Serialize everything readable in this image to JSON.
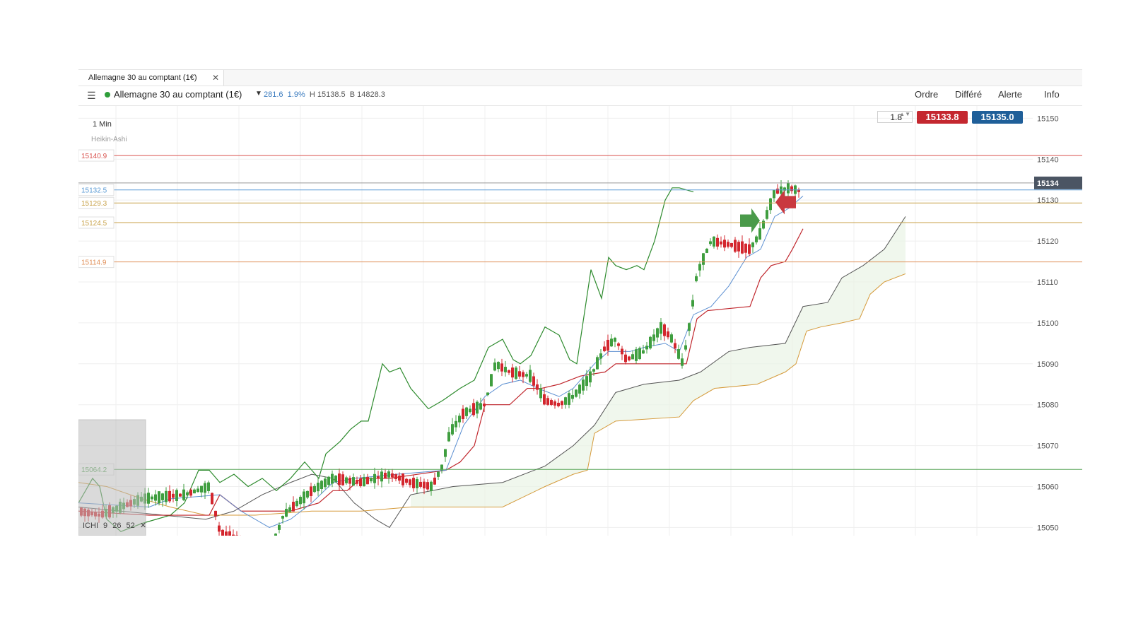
{
  "tab": {
    "label": "Allemagne 30 au comptant (1€)",
    "close": "✕"
  },
  "header": {
    "menu_icon": "☰",
    "instrument": "Allemagne 30 au comptant (1€)",
    "caret": "▼",
    "change": "281.6",
    "change_pct": "1.9%",
    "high": "H 15138.5",
    "low": "B 14828.3",
    "nav": [
      "Ordre",
      "Différé",
      "Alerte",
      "Info"
    ]
  },
  "toolbar": {
    "timeframe": "1 Min",
    "chart_type": "Heikin-Ashi",
    "quantity": "1.8",
    "qty_arrows": "▲▼",
    "sell_price": "15133.8",
    "buy_price": "15135.0"
  },
  "indicator": {
    "label": "ICHI 9 26 52",
    "close": "✕"
  },
  "colors": {
    "up": "#3f9e3f",
    "down": "#d3262e",
    "kijun": "#c0272d",
    "tenkan": "#5b8fd1",
    "chikou": "#2e8b2e",
    "cloud": "#e9f3e6",
    "span_a": "#555555",
    "span_b": "#d59a3a"
  },
  "chart_data": {
    "type": "candlestick",
    "y_axis": {
      "min": 15048,
      "max": 15153,
      "ticks": [
        "15150",
        "15140",
        "15130",
        "15120",
        "15110",
        "15100",
        "15090",
        "15080",
        "15070",
        "15060",
        "15050"
      ]
    },
    "levels": [
      {
        "value": 15140.9,
        "label": "15140.9",
        "color": "#d9534f"
      },
      {
        "value": 15134.2,
        "label": "15134",
        "color": "#999999",
        "current": true
      },
      {
        "value": 15132.5,
        "label": "15132.5",
        "color": "#5b9bd5"
      },
      {
        "value": 15129.3,
        "label": "15129.3",
        "color": "#c8a24a"
      },
      {
        "value": 15124.5,
        "label": "15124.5",
        "color": "#c8a24a"
      },
      {
        "value": 15114.9,
        "label": "15114.9",
        "color": "#e0905a"
      },
      {
        "value": 15064.2,
        "label": "15064.2",
        "color": "#5aa65a"
      }
    ]
  }
}
